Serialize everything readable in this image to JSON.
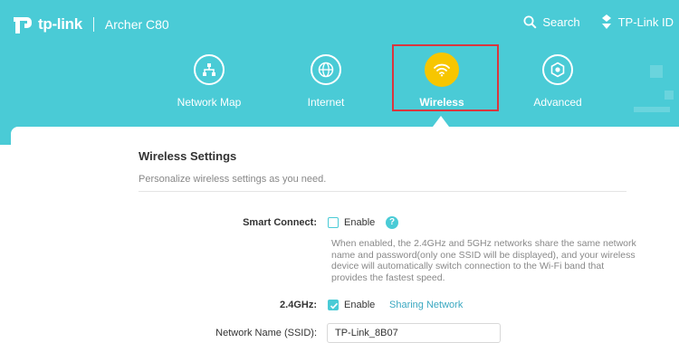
{
  "colors": {
    "header": "#4acbd6",
    "accent": "#f7c600",
    "highlight": "#d9363e",
    "link": "#3aa8c1"
  },
  "header": {
    "brand": "tp-link",
    "model": "Archer C80",
    "search_label": "Search",
    "account_label": "TP-Link ID"
  },
  "nav": {
    "tabs": [
      {
        "label": "Network Map",
        "icon": "network-map-icon"
      },
      {
        "label": "Internet",
        "icon": "globe-icon"
      },
      {
        "label": "Wireless",
        "icon": "wifi-icon",
        "active": true
      },
      {
        "label": "Advanced",
        "icon": "gear-icon"
      }
    ]
  },
  "wireless": {
    "title": "Wireless Settings",
    "subtitle": "Personalize wireless settings as you need.",
    "smart_connect": {
      "label": "Smart Connect:",
      "option": "Enable",
      "checked": false,
      "help": "?",
      "description": "When enabled, the 2.4GHz and 5GHz networks share the same network name and password(only one SSID will be displayed), and your wireless device will automatically switch connection to the Wi-Fi band that provides the fastest speed."
    },
    "band_24": {
      "label": "2.4GHz:",
      "option": "Enable",
      "checked": true,
      "link": "Sharing Network"
    },
    "ssid": {
      "label": "Network Name (SSID):",
      "value": "TP-Link_8B07"
    }
  }
}
